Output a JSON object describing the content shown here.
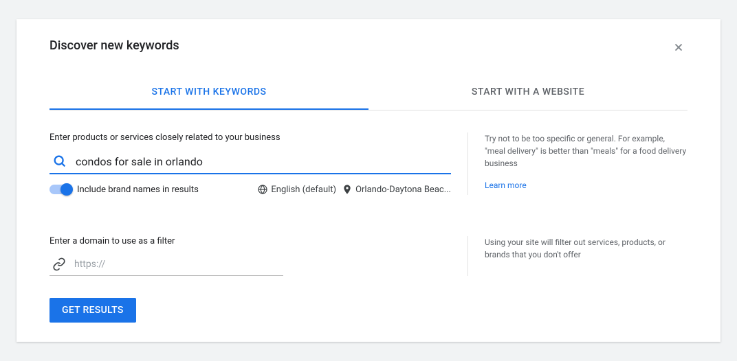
{
  "header": {
    "title": "Discover new keywords"
  },
  "tabs": {
    "keywords": "START WITH KEYWORDS",
    "website": "START WITH A WEBSITE"
  },
  "keywords_section": {
    "label": "Enter products or services closely related to your business",
    "input_value": "condos for sale in orlando",
    "toggle_label": "Include brand names in results",
    "language": "English (default)",
    "location": "Orlando-Daytona Beac...",
    "help_text": "Try not to be too specific or general. For example, \"meal delivery\" is better than \"meals\" for a food delivery business",
    "learn_more": "Learn more"
  },
  "domain_section": {
    "label": "Enter a domain to use as a filter",
    "placeholder": "https://",
    "help_text": "Using your site will filter out services, products, or brands that you don't offer"
  },
  "actions": {
    "get_results": "GET RESULTS"
  }
}
